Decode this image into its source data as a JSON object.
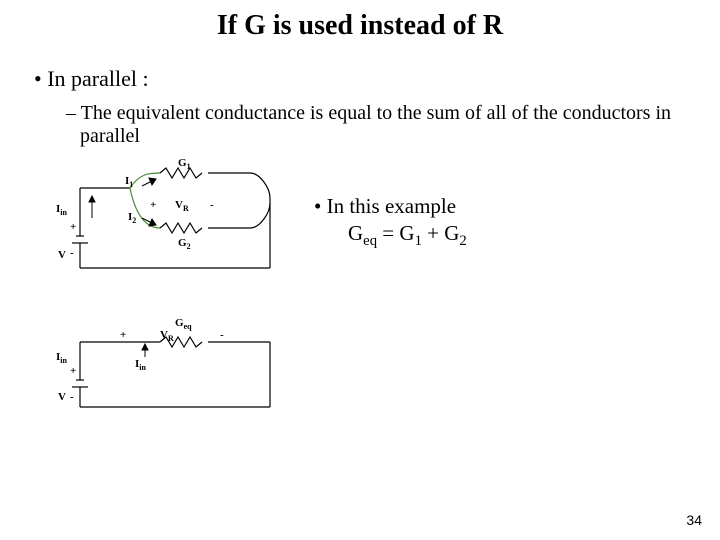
{
  "title": "If G is used instead of R",
  "bullet1": "In parallel :",
  "bullet2": "The equivalent conductance is equal to the sum of all of the conductors in parallel",
  "example_lead": "In this example",
  "eq_lhs": "G",
  "eq_lhs_sub": "eq",
  "eq_middle": " = G",
  "eq_s1": "1",
  "eq_plus": " + G",
  "eq_s2": "2",
  "labels": {
    "G1": "G",
    "G1sub": "1",
    "G2": "G",
    "G2sub": "2",
    "Geq": "G",
    "Geqsub": "eq",
    "I1": "I",
    "I1sub": "1",
    "I2": "I",
    "I2sub": "2",
    "Iin": "I",
    "Iinsub": "in",
    "VR": "V",
    "VRsub": "R",
    "V": "V",
    "plus": "+",
    "minus": "-"
  },
  "pagenum": "34"
}
